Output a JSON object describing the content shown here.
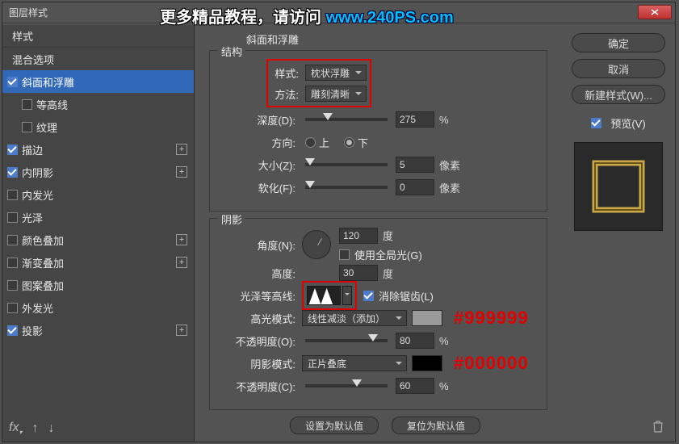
{
  "window": {
    "title": "图层样式"
  },
  "banner": {
    "text1": "更多精品教程，请访问 ",
    "url": "www.240PS.com"
  },
  "sidebar": {
    "header": "样式",
    "blending": "混合选项",
    "items": [
      {
        "label": "斜面和浮雕",
        "checked": true,
        "active": true
      },
      {
        "label": "等高线",
        "checked": false,
        "indent": true
      },
      {
        "label": "纹理",
        "checked": false,
        "indent": true
      },
      {
        "label": "描边",
        "checked": true,
        "plus": true
      },
      {
        "label": "内阴影",
        "checked": true,
        "plus": true
      },
      {
        "label": "内发光",
        "checked": false
      },
      {
        "label": "光泽",
        "checked": false
      },
      {
        "label": "颜色叠加",
        "checked": false,
        "plus": true
      },
      {
        "label": "渐变叠加",
        "checked": false,
        "plus": true
      },
      {
        "label": "图案叠加",
        "checked": false
      },
      {
        "label": "外发光",
        "checked": false
      },
      {
        "label": "投影",
        "checked": true,
        "plus": true
      }
    ]
  },
  "main": {
    "title": "斜面和浮雕",
    "structure": {
      "legend": "结构",
      "style_label": "样式:",
      "style_value": "枕状浮雕",
      "technique_label": "方法:",
      "technique_value": "雕刻清晰",
      "depth_label": "深度(D):",
      "depth_value": "275",
      "depth_unit": "%",
      "direction_label": "方向:",
      "direction_up": "上",
      "direction_down": "下",
      "size_label": "大小(Z):",
      "size_value": "5",
      "size_unit": "像素",
      "soften_label": "软化(F):",
      "soften_value": "0",
      "soften_unit": "像素"
    },
    "shading": {
      "legend": "阴影",
      "angle_label": "角度(N):",
      "angle_value": "120",
      "angle_unit": "度",
      "global_light_label": "使用全局光(G)",
      "altitude_label": "高度:",
      "altitude_value": "30",
      "altitude_unit": "度",
      "gloss_label": "光泽等高线:",
      "antialias_label": "消除锯齿(L)",
      "highlight_mode_label": "高光模式:",
      "highlight_mode_value": "线性减淡（添加）",
      "highlight_color": "#999999",
      "highlight_note": "#999999",
      "highlight_opacity_label": "不透明度(O):",
      "highlight_opacity_value": "80",
      "opacity_unit": "%",
      "shadow_mode_label": "阴影模式:",
      "shadow_mode_value": "正片叠底",
      "shadow_color": "#000000",
      "shadow_note": "#000000",
      "shadow_opacity_label": "不透明度(C):",
      "shadow_opacity_value": "60"
    },
    "buttons": {
      "default": "设置为默认值",
      "reset": "复位为默认值"
    }
  },
  "right": {
    "ok": "确定",
    "cancel": "取消",
    "new_style": "新建样式(W)...",
    "preview": "预览(V)"
  }
}
